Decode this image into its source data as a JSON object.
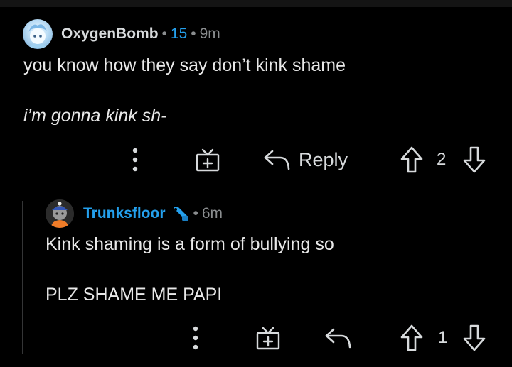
{
  "comments": [
    {
      "username": "OxygenBomb",
      "score": "15",
      "time": "9m",
      "body_lines": [
        "you know how they say don’t kink shame",
        "i’m gonna kink sh-"
      ],
      "actions": {
        "reply_label": "Reply",
        "vote_count": "2"
      }
    },
    {
      "username": "Trunksfloor",
      "time": "6m",
      "body_lines": [
        "Kink shaming is a form of bullying so",
        "PLZ SHAME ME PAPI"
      ],
      "actions": {
        "vote_count": "1"
      }
    }
  ],
  "separator": "•",
  "icons": {
    "more": "more-options-icon",
    "award": "award-gift-icon",
    "reply": "reply-arrow-icon",
    "upvote": "upvote-arrow-icon",
    "downvote": "downvote-arrow-icon",
    "flair": "wrench-flair-icon"
  },
  "colors": {
    "background": "#000000",
    "text": "#d7dadc",
    "muted": "#8a8d8f",
    "accent": "#24a0ed",
    "thread_line": "#343536"
  }
}
